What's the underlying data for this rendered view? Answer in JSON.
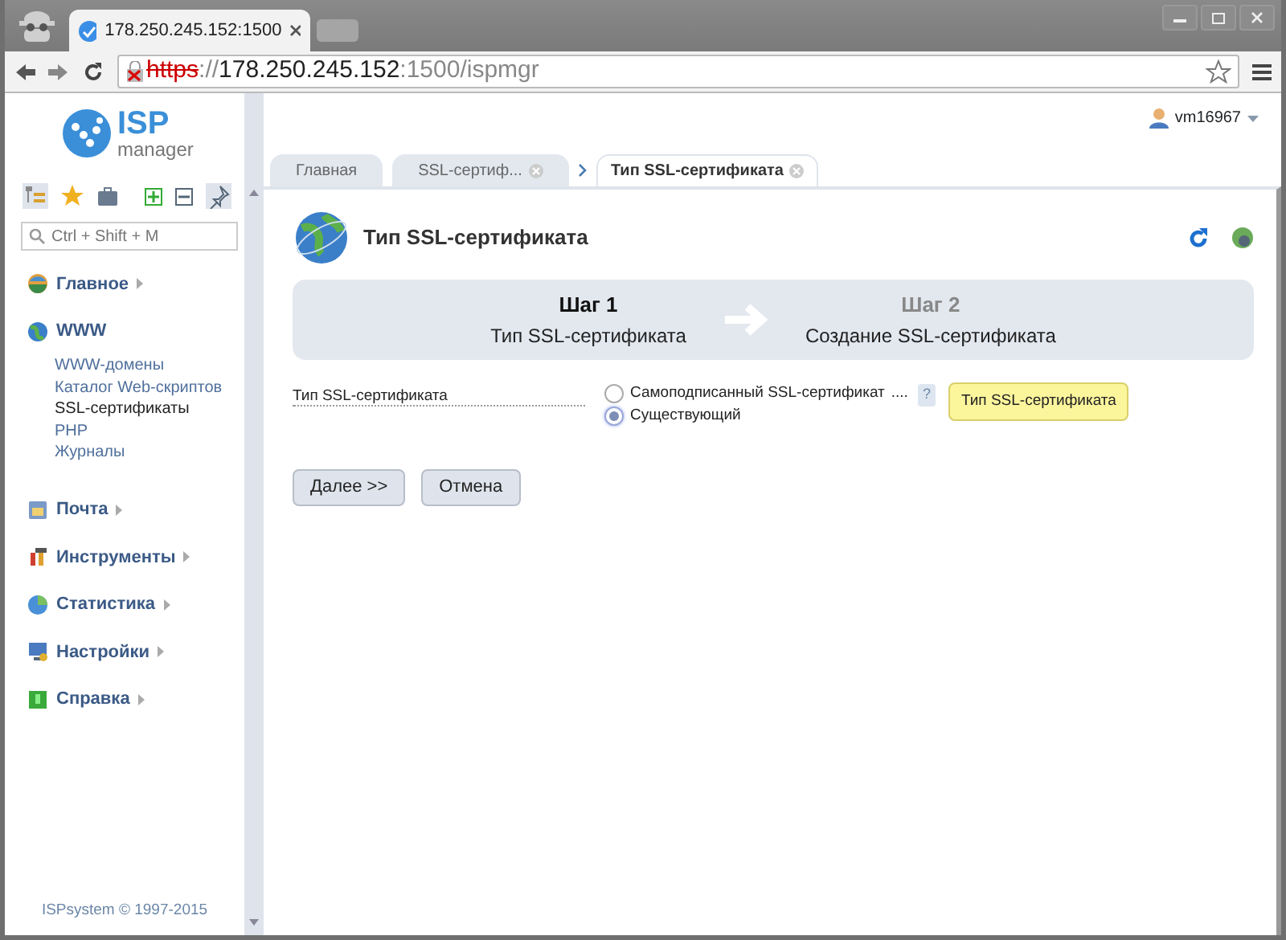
{
  "browser": {
    "tab_title": "178.250.245.152:1500",
    "address": [
      {
        "kind": "scheme",
        "text": "https"
      },
      {
        "kind": "faint",
        "text": "://"
      },
      {
        "kind": "host",
        "text": "178.250.245.152"
      },
      {
        "kind": "faint",
        "text": ":1500/ispmgr"
      }
    ]
  },
  "header": {
    "logo": {
      "line1": "ISP",
      "line2": "manager"
    },
    "user": "vm16967"
  },
  "sidebar": {
    "search": {
      "placeholder": "Ctrl + Shift + M"
    },
    "menu": [
      {
        "label": "Главное",
        "expanded": false
      },
      {
        "label": "WWW",
        "expanded": true,
        "children": [
          {
            "label": "WWW-домены",
            "selected": false
          },
          {
            "label": "Каталог Web-скриптов",
            "selected": false
          },
          {
            "label": "SSL-сертификаты",
            "selected": true
          },
          {
            "label": "PHP",
            "selected": false
          },
          {
            "label": "Журналы",
            "selected": false
          }
        ]
      },
      {
        "label": "Почта",
        "expanded": false
      },
      {
        "label": "Инструменты",
        "expanded": false
      },
      {
        "label": "Статистика",
        "expanded": false
      },
      {
        "label": "Настройки",
        "expanded": false
      },
      {
        "label": "Справка",
        "expanded": false
      }
    ],
    "footer": "ISPsystem © 1997-2015"
  },
  "tabs": [
    {
      "label": "Главная",
      "selected": false,
      "closable": false,
      "chevron_after": false
    },
    {
      "label": "SSL-сертиф...",
      "selected": false,
      "closable": true,
      "chevron_after": true
    },
    {
      "label": "Тип SSL-сертификата",
      "selected": true,
      "closable": true,
      "chevron_after": false
    }
  ],
  "page": {
    "title": "Тип SSL-сертификата",
    "steps": [
      {
        "number": "Шаг 1",
        "label": "Тип SSL-сертификата",
        "active": true
      },
      {
        "number": "Шаг 2",
        "label": "Создание SSL-сертификата",
        "active": false
      }
    ],
    "form": {
      "label": "Тип SSL-сертификата",
      "options": [
        {
          "label": "Самоподписанный SSL-сертификат",
          "selected": false
        },
        {
          "label": "Существующий",
          "selected": true
        }
      ],
      "leader": "....",
      "hint": "?",
      "tooltip": "Тип SSL-сертификата"
    },
    "buttons": [
      "Далее >>",
      "Отмена"
    ]
  }
}
